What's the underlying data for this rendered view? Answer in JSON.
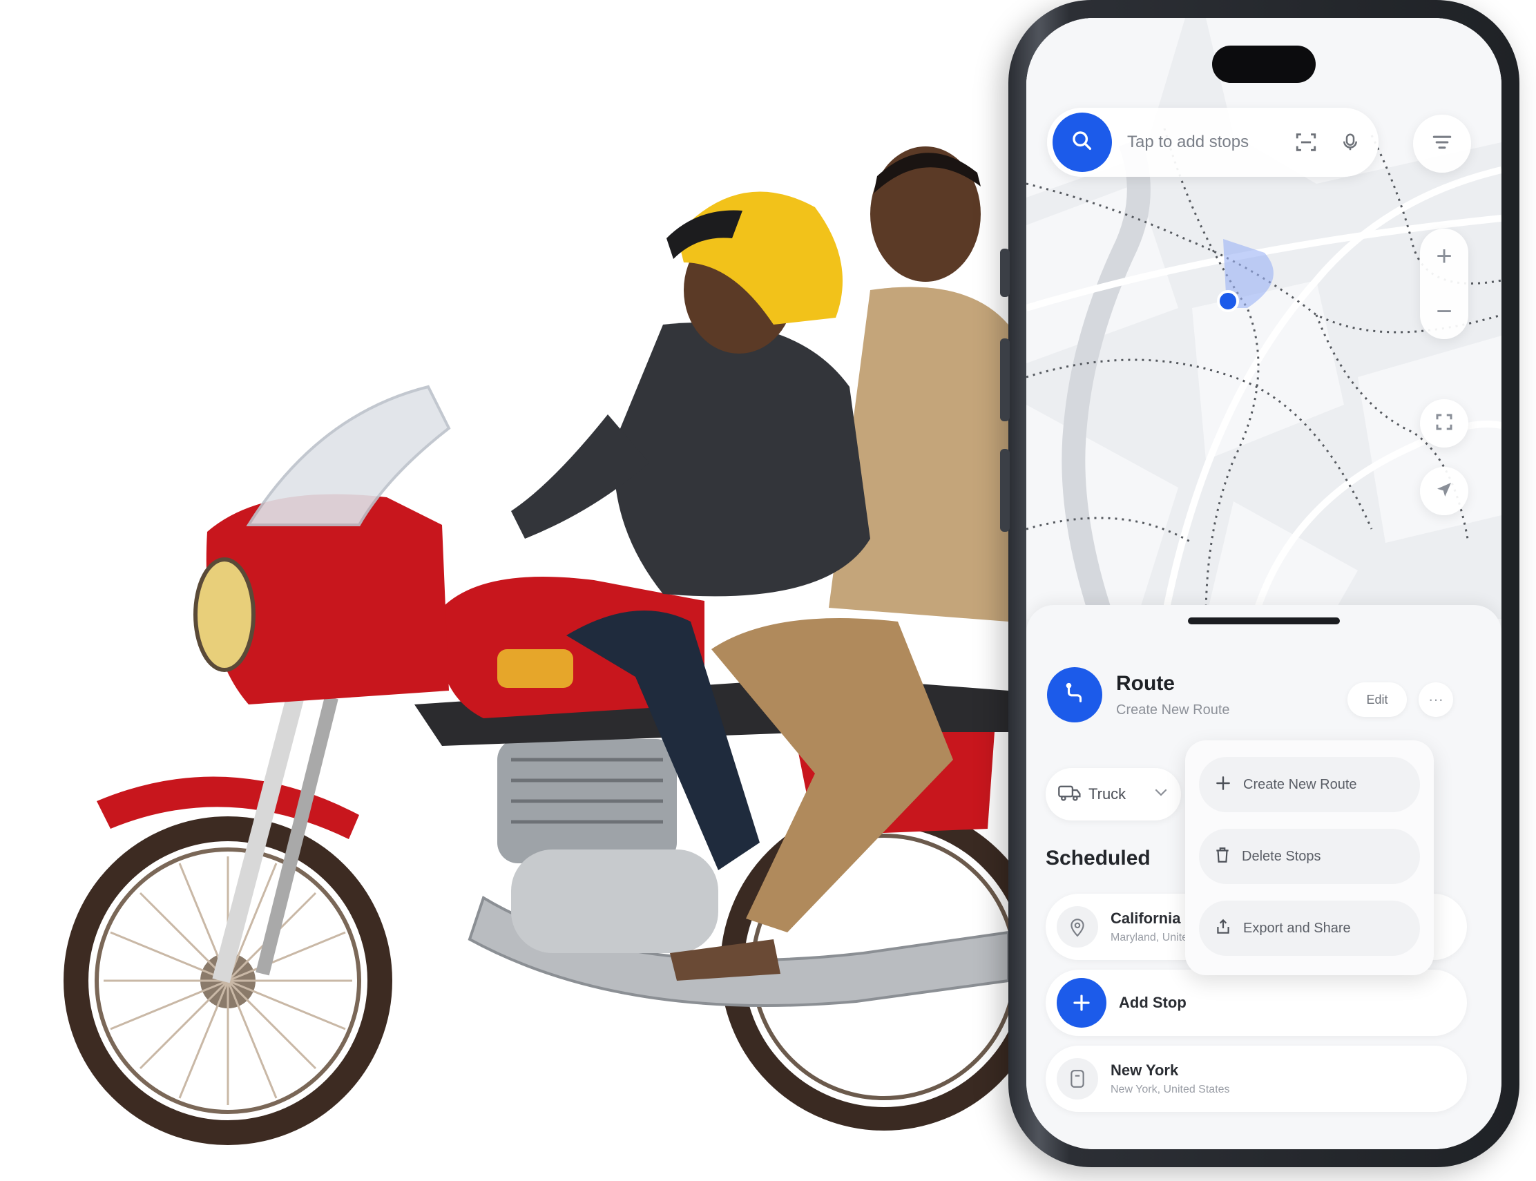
{
  "search": {
    "placeholder": "Tap to add stops"
  },
  "map_controls": {
    "zoom_in_label": "+",
    "zoom_out_label": "−"
  },
  "route": {
    "title": "Route",
    "subtitle": "Create New Route",
    "edit_label": "Edit",
    "more_label": "···"
  },
  "vehicle": {
    "selected": "Truck"
  },
  "menu": {
    "items": [
      {
        "label": "Create New Route",
        "icon": "plus-icon"
      },
      {
        "label": "Delete Stops",
        "icon": "trash-icon"
      },
      {
        "label": "Export and Share",
        "icon": "export-icon"
      }
    ]
  },
  "scheduled": {
    "title": "Scheduled",
    "stops": [
      {
        "name": "California",
        "address": "Maryland, United"
      },
      {
        "name": "New York",
        "address": "New York, United States"
      }
    ],
    "add_stop_label": "Add Stop"
  },
  "colors": {
    "accent": "#1c5bea",
    "bike_red": "#c8161d"
  }
}
